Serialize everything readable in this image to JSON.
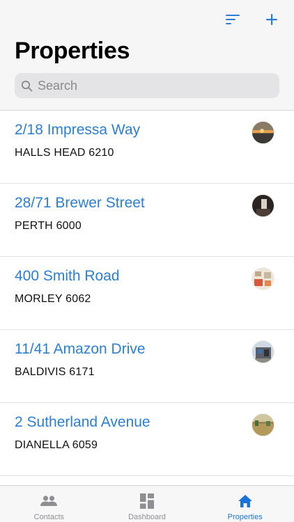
{
  "header": {
    "title": "Properties",
    "sort_icon": "sort-icon",
    "add_icon": "plus-icon",
    "accent_color": "#2a7fd4"
  },
  "search": {
    "placeholder": "Search",
    "value": ""
  },
  "properties": [
    {
      "street": "2/18 Impressa Way",
      "suburb": "HALLS HEAD 6210",
      "thumbnail": "sunset-photo"
    },
    {
      "street": "28/71 Brewer Street",
      "suburb": "PERTH 6000",
      "thumbnail": "interior-photo"
    },
    {
      "street": "400 Smith Road",
      "suburb": "MORLEY 6062",
      "thumbnail": "room-photo"
    },
    {
      "street": "11/41 Amazon Drive",
      "suburb": "BALDIVIS 6171",
      "thumbnail": "house-facade-photo"
    },
    {
      "street": "2 Sutherland Avenue",
      "suburb": "DIANELLA 6059",
      "thumbnail": "land-photo"
    }
  ],
  "tabbar": {
    "tabs": [
      {
        "label": "Contacts",
        "icon": "people-icon",
        "active": false
      },
      {
        "label": "Dashboard",
        "icon": "dashboard-icon",
        "active": false
      },
      {
        "label": "Properties",
        "icon": "home-icon",
        "active": true
      }
    ],
    "active_color": "#1a73d9",
    "inactive_color": "#8e8e93"
  }
}
